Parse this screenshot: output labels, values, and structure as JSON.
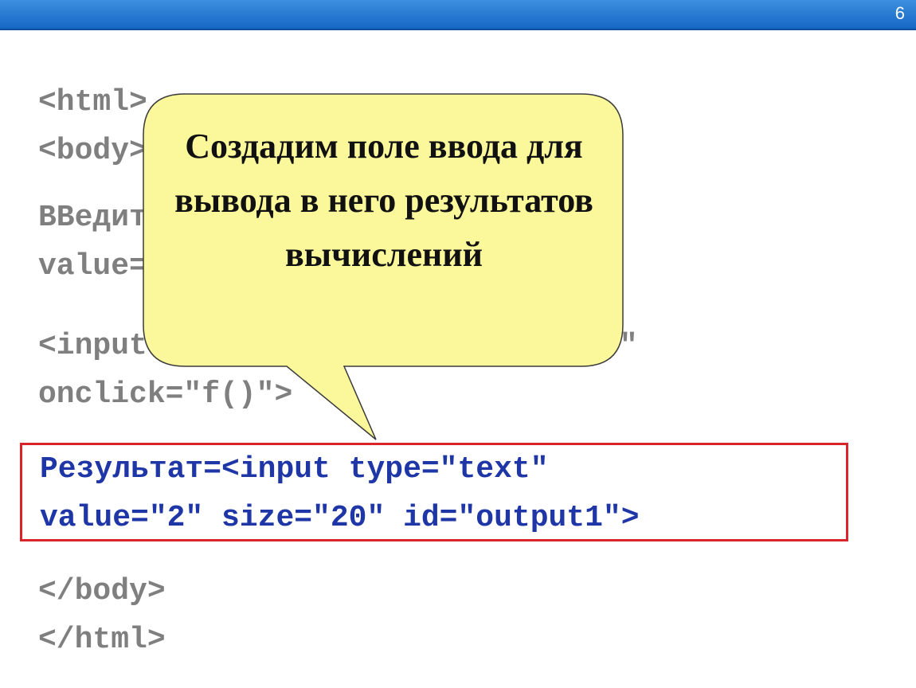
{
  "slide_number": "6",
  "code_before": "<html>\n<body>",
  "code_input_block": "ВВедите число <input type=\"text\"\nvalue=\"1\" size=\"20\" id=\"input1\">",
  "code_button_block": "<input type=\"button\" value=\"Счет\"\nonclick=\"f()\">",
  "highlighted_code": "Результат=<input type=\"text\"\nvalue=\"2\" size=\"20\" id=\"output1\">",
  "code_after": "</body>\n</html>",
  "callout_text": "Создадим поле ввода для вывода в него результатов вычислений",
  "colors": {
    "header_bar": "#1e73d2",
    "code_gray": "#7f7f7f",
    "code_highlight": "#1f36a7",
    "highlight_border": "#d9242b",
    "callout_fill": "#fbf89b"
  }
}
